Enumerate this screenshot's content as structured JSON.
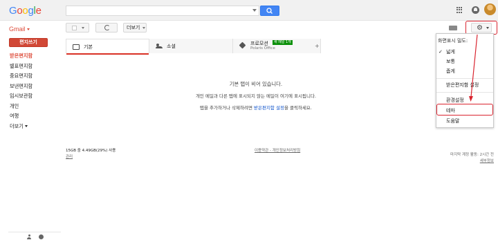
{
  "header": {
    "logo_letters": [
      "G",
      "o",
      "o",
      "g",
      "l",
      "e"
    ]
  },
  "gmail": {
    "label": "Gmail"
  },
  "toolbar": {
    "more_label": "더보기"
  },
  "sidebar": {
    "compose_label": "편지쓰기",
    "items": [
      {
        "label": "받은편지함",
        "active": true
      },
      {
        "label": "별표편지함"
      },
      {
        "label": "중요편지함"
      },
      {
        "label": "보낸편지함"
      },
      {
        "label": "임시보관함"
      },
      {
        "label": "개인"
      },
      {
        "label": "여행"
      },
      {
        "label": "더보기"
      }
    ]
  },
  "tabs": [
    {
      "label": "기본",
      "icon": "inbox-icon"
    },
    {
      "label": "소셜",
      "icon": "people-icon"
    },
    {
      "label": "프로모션",
      "badge": "새 메일 1개",
      "sub": "Polaris Office",
      "icon": "tag-icon"
    }
  ],
  "tab_add": "+",
  "empty_state": {
    "line1": "기본 탭이 비어 있습니다.",
    "line2": "개인 메일과 다른 탭에 표시되지 않는 메일이 여기에 표시됩니다.",
    "line3_prefix": "탭을 추가하거나 삭제하려면 ",
    "line3_link": "받은편지함 설정",
    "line3_suffix": "을 클릭하세요."
  },
  "footer": {
    "storage": "15GB 중 4.49GB(29%) 사용",
    "manage": "관리",
    "policy": "이용약관 - 개인정보처리방침",
    "last_activity": "마지막 계정 활동: 2시간 전",
    "details": "세부정보"
  },
  "settings_menu": {
    "density_heading": "화면표시 밀도:",
    "density_options": [
      "넓게",
      "보통",
      "좁게"
    ],
    "selected_density": "넓게",
    "inbox_settings": "받은편지함 설정",
    "settings": "환경설정",
    "themes": "테마",
    "help": "도움말"
  },
  "colors": {
    "accent_red": "#d14836",
    "annotation_red": "#d9232e",
    "link_blue": "#1155cc",
    "search_blue": "#4285f4"
  }
}
